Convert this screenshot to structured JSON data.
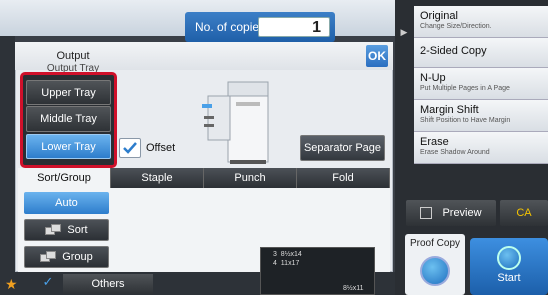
{
  "header": {
    "copies_label": "No. of copies",
    "copies_value": "1"
  },
  "output": {
    "title": "Output",
    "subtitle": "Output Tray",
    "ok_label": "OK"
  },
  "trays": [
    "Upper Tray",
    "Middle Tray",
    "Lower Tray"
  ],
  "offset": {
    "label": "Offset",
    "checked": true
  },
  "separator_label": "Separator Page",
  "tabs": [
    "Sort/Group",
    "Staple",
    "Punch",
    "Fold"
  ],
  "sort_group": [
    "Auto",
    "Sort",
    "Group"
  ],
  "bottom": {
    "others_label": "Others",
    "paper": [
      {
        "slot": "3",
        "size": "8½x14"
      },
      {
        "slot": "4",
        "size": "11x17"
      }
    ],
    "paper_extra": "8½x11"
  },
  "right_menu": [
    {
      "title": "Original",
      "sub": "Change Size/Direction."
    },
    {
      "title": "2-Sided Copy",
      "sub": ""
    },
    {
      "title": "N-Up",
      "sub": "Put Multiple Pages in A Page"
    },
    {
      "title": "Margin Shift",
      "sub": "Shift Position to Have Margin"
    },
    {
      "title": "Erase",
      "sub": "Erase Shadow Around"
    }
  ],
  "actions": {
    "preview": "Preview",
    "ca": "CA",
    "proof": "Proof Copy",
    "start": "Start"
  },
  "colors": {
    "accent_blue": "#2d7dcc",
    "highlight_red": "#d0102a",
    "ca_yellow": "#f5c400"
  }
}
